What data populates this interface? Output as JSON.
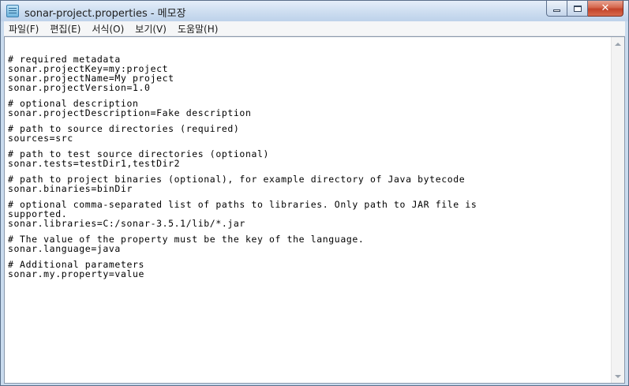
{
  "window": {
    "title": "sonar-project.properties - 메모장",
    "app_icon": "notepad-icon",
    "caption_buttons": {
      "minimize_icon": "minimize-icon",
      "maximize_icon": "maximize-icon",
      "close_icon": "close-icon",
      "close_glyph": "✕"
    }
  },
  "menubar": {
    "items": [
      {
        "label": "파일(F)"
      },
      {
        "label": "편집(E)"
      },
      {
        "label": "서식(O)"
      },
      {
        "label": "보기(V)"
      },
      {
        "label": "도움말(H)"
      }
    ]
  },
  "editor": {
    "lines": [
      "# required metadata",
      "sonar.projectKey=my:project",
      "sonar.projectName=My project",
      "sonar.projectVersion=1.0",
      "",
      "# optional description",
      "sonar.projectDescription=Fake description",
      "",
      "# path to source directories (required)",
      "sources=src",
      "",
      "# path to test source directories (optional)",
      "sonar.tests=testDir1,testDir2",
      "",
      "# path to project binaries (optional), for example directory of Java bytecode",
      "sonar.binaries=binDir",
      "",
      "# optional comma-separated list of paths to libraries. Only path to JAR file is",
      "supported.",
      "sonar.libraries=C:/sonar-3.5.1/lib/*.jar",
      "",
      "# The value of the property must be the key of the language.",
      "sonar.language=java",
      "",
      "# Additional parameters",
      "sonar.my.property=value"
    ]
  },
  "colors": {
    "title_bar": "#cfdff1",
    "close_button": "#c2432a",
    "menu_bar": "#f5f6f7",
    "text": "#000000"
  }
}
